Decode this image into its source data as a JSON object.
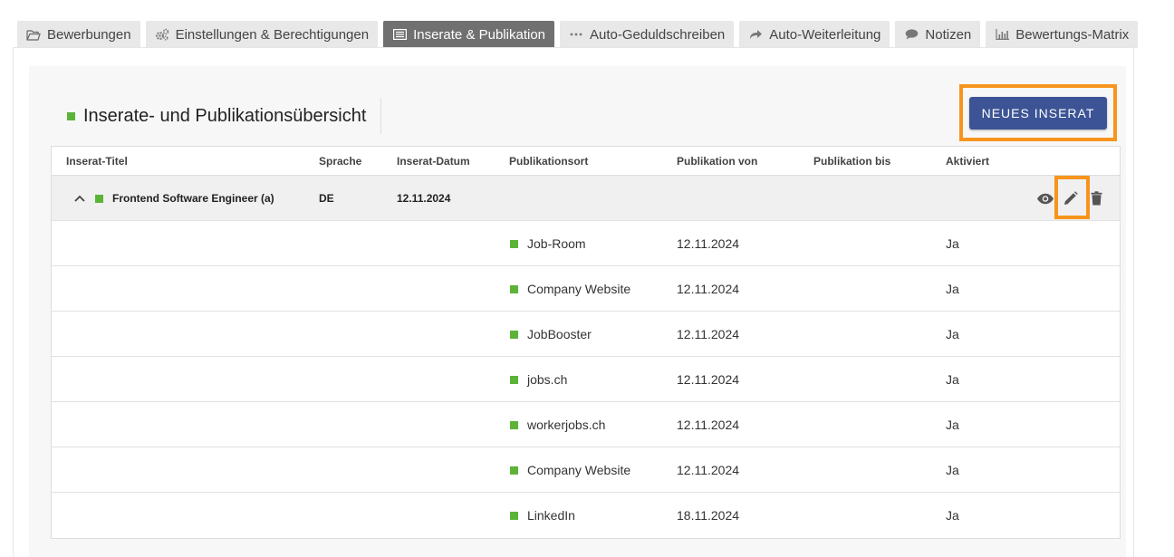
{
  "tabs": [
    {
      "label": "Bewerbungen",
      "icon": "folder-open-icon",
      "active": false
    },
    {
      "label": "Einstellungen & Berechtigungen",
      "icon": "gears-icon",
      "active": false
    },
    {
      "label": "Inserate & Publikation",
      "icon": "list-icon",
      "active": true
    },
    {
      "label": "Auto-Geduldschreiben",
      "icon": "ellipsis-icon",
      "active": false
    },
    {
      "label": "Auto-Weiterleitung",
      "icon": "share-arrow-icon",
      "active": false
    },
    {
      "label": "Notizen",
      "icon": "speech-bubble-icon",
      "active": false
    },
    {
      "label": "Bewertungs-Matrix",
      "icon": "bar-chart-icon",
      "active": false
    }
  ],
  "header": {
    "title": "Inserate- und Publikationsübersicht",
    "new_button": "NEUES INSERAT"
  },
  "colors": {
    "accent_green": "#5cb338",
    "primary_button": "#3c5495",
    "highlight_orange": "#f7941d",
    "active_tab": "#707070"
  },
  "table": {
    "columns": [
      "Inserat-Titel",
      "Sprache",
      "Inserat-Datum",
      "Publikationsort",
      "Publikation von",
      "Publikation bis",
      "Aktiviert"
    ],
    "group": {
      "title": "Frontend Software Engineer (a)",
      "language": "DE",
      "date": "12.11.2024",
      "actions": [
        "eye-icon",
        "pencil-icon",
        "trash-icon"
      ]
    },
    "rows": [
      {
        "place": "Job-Room",
        "from": "12.11.2024",
        "to": "",
        "active": "Ja"
      },
      {
        "place": "Company Website",
        "from": "12.11.2024",
        "to": "",
        "active": "Ja"
      },
      {
        "place": "JobBooster",
        "from": "12.11.2024",
        "to": "",
        "active": "Ja"
      },
      {
        "place": "jobs.ch",
        "from": "12.11.2024",
        "to": "",
        "active": "Ja"
      },
      {
        "place": "workerjobs.ch",
        "from": "12.11.2024",
        "to": "",
        "active": "Ja"
      },
      {
        "place": "Company Website",
        "from": "12.11.2024",
        "to": "",
        "active": "Ja"
      },
      {
        "place": "LinkedIn",
        "from": "18.11.2024",
        "to": "",
        "active": "Ja"
      }
    ]
  }
}
